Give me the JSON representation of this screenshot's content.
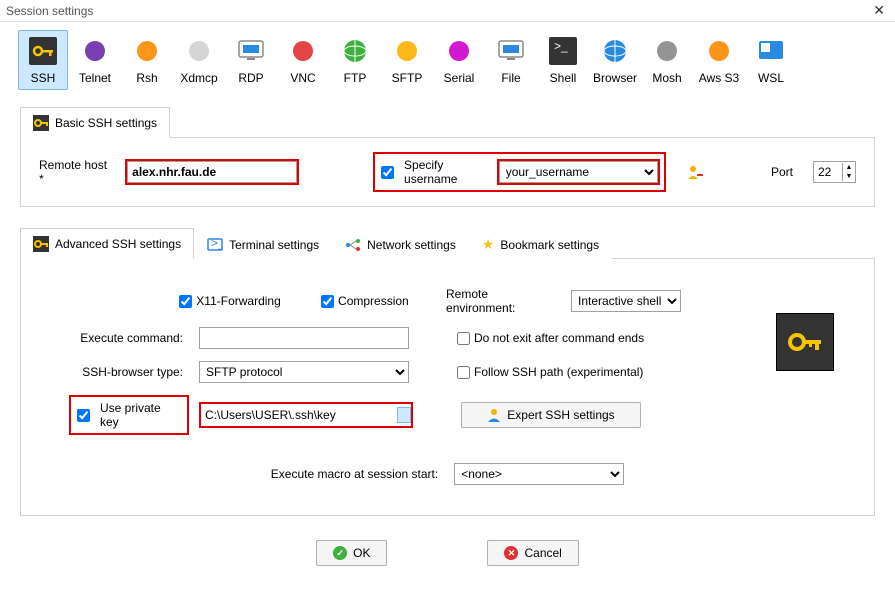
{
  "titlebar": {
    "title": "Session settings"
  },
  "toolbar": {
    "items": [
      {
        "label": "SSH",
        "color": "#f6c400"
      },
      {
        "label": "Telnet",
        "color": "#6b2aa8"
      },
      {
        "label": "Rsh",
        "color": "#ff8a00"
      },
      {
        "label": "Xdmcp",
        "color": "#d0d0d0"
      },
      {
        "label": "RDP",
        "color": "#2a8ae0"
      },
      {
        "label": "VNC",
        "color": "#e03030"
      },
      {
        "label": "FTP",
        "color": "#3db03d"
      },
      {
        "label": "SFTP",
        "color": "#ffb000"
      },
      {
        "label": "Serial",
        "color": "#cc00cc"
      },
      {
        "label": "File",
        "color": "#2a8ae0"
      },
      {
        "label": "Shell",
        "color": "#333333"
      },
      {
        "label": "Browser",
        "color": "#2a8ae0"
      },
      {
        "label": "Mosh",
        "color": "#888888"
      },
      {
        "label": "Aws S3",
        "color": "#ff8a00"
      },
      {
        "label": "WSL",
        "color": "#2a8ae0"
      }
    ]
  },
  "basic": {
    "tab_label": "Basic SSH settings",
    "remote_host_label": "Remote host *",
    "remote_host_value": "alex.nhr.fau.de",
    "specify_username_label": "Specify username",
    "username_value": "your_username",
    "port_label": "Port",
    "port_value": "22"
  },
  "adv_tabs": {
    "advanced": "Advanced SSH settings",
    "terminal": "Terminal settings",
    "network": "Network settings",
    "bookmark": "Bookmark settings"
  },
  "adv": {
    "x11_label": "X11-Forwarding",
    "compression_label": "Compression",
    "remote_env_label": "Remote environment:",
    "remote_env_value": "Interactive shell",
    "execute_cmd_label": "Execute command:",
    "execute_cmd_value": "",
    "do_not_exit_label": "Do not exit after command ends",
    "browser_label": "SSH-browser type:",
    "browser_value": "SFTP protocol",
    "follow_label": "Follow SSH path (experimental)",
    "use_key_label": "Use private key",
    "key_path": "C:\\Users\\USER\\.ssh\\key",
    "expert_label": "Expert SSH settings",
    "macro_label": "Execute macro at session start:",
    "macro_value": "<none>"
  },
  "buttons": {
    "ok": "OK",
    "cancel": "Cancel"
  }
}
